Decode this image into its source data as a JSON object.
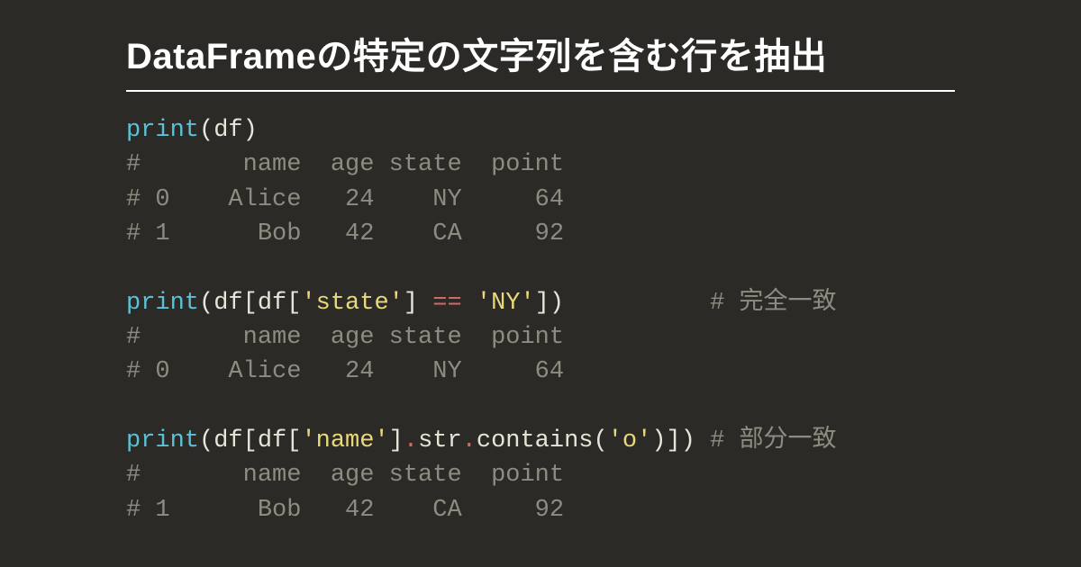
{
  "title": "DataFrameの特定の文字列を含む行を抽出",
  "code": {
    "fn": "print",
    "ident_df": "df",
    "str_state": "'state'",
    "op_eq": "==",
    "str_ny": "'NY'",
    "str_name": "'name'",
    "attr_str": "str",
    "attr_contains": "contains",
    "str_o": "'o'",
    "cmt_full": "# 完全一致",
    "cmt_partial": "# 部分一致",
    "out_header": "#       name  age state  point",
    "out_row0": "# 0    Alice   24    NY     64",
    "out_row1": "# 1      Bob   42    CA     92"
  }
}
